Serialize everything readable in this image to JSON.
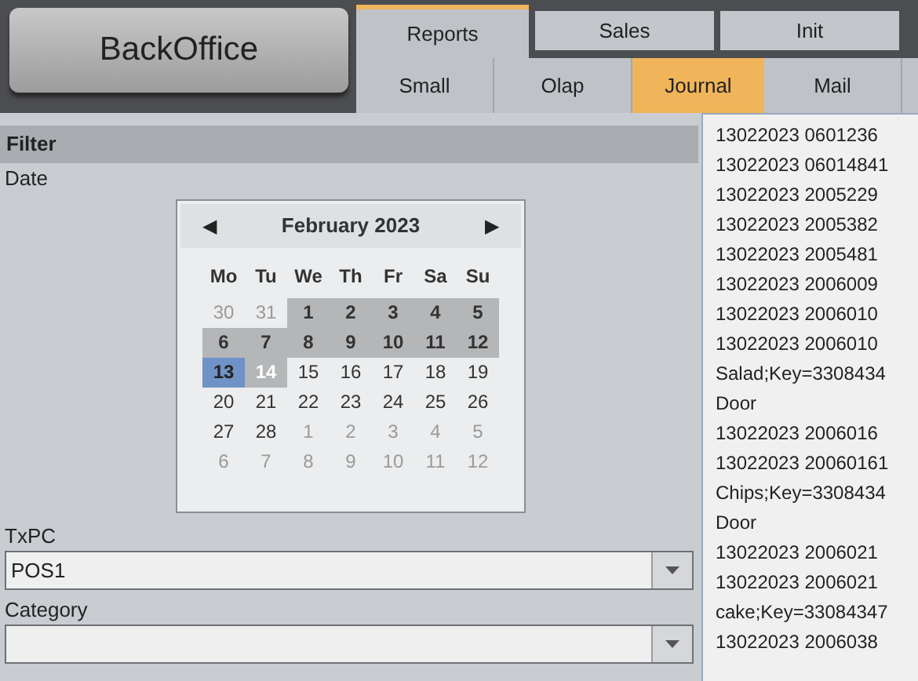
{
  "app_button": "BackOffice",
  "top_tabs": [
    {
      "label": "Reports",
      "selected": true
    },
    {
      "label": "Sales",
      "selected": false
    },
    {
      "label": "Init",
      "selected": false
    }
  ],
  "sub_tabs": [
    {
      "label": "Small",
      "selected": false
    },
    {
      "label": "Olap",
      "selected": false
    },
    {
      "label": "Journal",
      "selected": true
    },
    {
      "label": "Mail",
      "selected": false
    }
  ],
  "filter": {
    "title": "Filter",
    "date_label": "Date",
    "calendar": {
      "month": "February 2023",
      "prev": "◀",
      "next": "▶",
      "weekdays": [
        "Mo",
        "Tu",
        "We",
        "Th",
        "Fr",
        "Sa",
        "Su"
      ],
      "days": [
        {
          "day": "30",
          "other_month": true,
          "in_range": false,
          "selected": false,
          "today": false
        },
        {
          "day": "31",
          "other_month": true,
          "in_range": false,
          "selected": false,
          "today": false
        },
        {
          "day": "1",
          "other_month": false,
          "in_range": true,
          "selected": false,
          "today": false
        },
        {
          "day": "2",
          "other_month": false,
          "in_range": true,
          "selected": false,
          "today": false
        },
        {
          "day": "3",
          "other_month": false,
          "in_range": true,
          "selected": false,
          "today": false
        },
        {
          "day": "4",
          "other_month": false,
          "in_range": true,
          "selected": false,
          "today": false
        },
        {
          "day": "5",
          "other_month": false,
          "in_range": true,
          "selected": false,
          "today": false
        },
        {
          "day": "6",
          "other_month": false,
          "in_range": true,
          "selected": false,
          "today": false
        },
        {
          "day": "7",
          "other_month": false,
          "in_range": true,
          "selected": false,
          "today": false
        },
        {
          "day": "8",
          "other_month": false,
          "in_range": true,
          "selected": false,
          "today": false
        },
        {
          "day": "9",
          "other_month": false,
          "in_range": true,
          "selected": false,
          "today": false
        },
        {
          "day": "10",
          "other_month": false,
          "in_range": true,
          "selected": false,
          "today": false
        },
        {
          "day": "11",
          "other_month": false,
          "in_range": true,
          "selected": false,
          "today": false
        },
        {
          "day": "12",
          "other_month": false,
          "in_range": true,
          "selected": false,
          "today": false
        },
        {
          "day": "13",
          "other_month": false,
          "in_range": false,
          "selected": true,
          "today": false
        },
        {
          "day": "14",
          "other_month": false,
          "in_range": false,
          "selected": false,
          "today": true
        },
        {
          "day": "15",
          "other_month": false,
          "in_range": false,
          "selected": false,
          "today": false
        },
        {
          "day": "16",
          "other_month": false,
          "in_range": false,
          "selected": false,
          "today": false
        },
        {
          "day": "17",
          "other_month": false,
          "in_range": false,
          "selected": false,
          "today": false
        },
        {
          "day": "18",
          "other_month": false,
          "in_range": false,
          "selected": false,
          "today": false
        },
        {
          "day": "19",
          "other_month": false,
          "in_range": false,
          "selected": false,
          "today": false
        },
        {
          "day": "20",
          "other_month": false,
          "in_range": false,
          "selected": false,
          "today": false
        },
        {
          "day": "21",
          "other_month": false,
          "in_range": false,
          "selected": false,
          "today": false
        },
        {
          "day": "22",
          "other_month": false,
          "in_range": false,
          "selected": false,
          "today": false
        },
        {
          "day": "23",
          "other_month": false,
          "in_range": false,
          "selected": false,
          "today": false
        },
        {
          "day": "24",
          "other_month": false,
          "in_range": false,
          "selected": false,
          "today": false
        },
        {
          "day": "25",
          "other_month": false,
          "in_range": false,
          "selected": false,
          "today": false
        },
        {
          "day": "26",
          "other_month": false,
          "in_range": false,
          "selected": false,
          "today": false
        },
        {
          "day": "27",
          "other_month": false,
          "in_range": false,
          "selected": false,
          "today": false
        },
        {
          "day": "28",
          "other_month": false,
          "in_range": false,
          "selected": false,
          "today": false
        },
        {
          "day": "1",
          "other_month": true,
          "in_range": false,
          "selected": false,
          "today": false
        },
        {
          "day": "2",
          "other_month": true,
          "in_range": false,
          "selected": false,
          "today": false
        },
        {
          "day": "3",
          "other_month": true,
          "in_range": false,
          "selected": false,
          "today": false
        },
        {
          "day": "4",
          "other_month": true,
          "in_range": false,
          "selected": false,
          "today": false
        },
        {
          "day": "5",
          "other_month": true,
          "in_range": false,
          "selected": false,
          "today": false
        },
        {
          "day": "6",
          "other_month": true,
          "in_range": false,
          "selected": false,
          "today": false
        },
        {
          "day": "7",
          "other_month": true,
          "in_range": false,
          "selected": false,
          "today": false
        },
        {
          "day": "8",
          "other_month": true,
          "in_range": false,
          "selected": false,
          "today": false
        },
        {
          "day": "9",
          "other_month": true,
          "in_range": false,
          "selected": false,
          "today": false
        },
        {
          "day": "10",
          "other_month": true,
          "in_range": false,
          "selected": false,
          "today": false
        },
        {
          "day": "11",
          "other_month": true,
          "in_range": false,
          "selected": false,
          "today": false
        },
        {
          "day": "12",
          "other_month": true,
          "in_range": false,
          "selected": false,
          "today": false
        }
      ]
    },
    "txpc": {
      "label": "TxPC",
      "value": "POS1"
    },
    "category": {
      "label": "Category"
    }
  },
  "journal_lines": [
    "13022023 0601236",
    "13022023 06014841",
    "13022023 2005229",
    "13022023 2005382",
    "13022023 2005481",
    "13022023 2006009",
    "13022023 2006010",
    "13022023 2006010",
    "Salad;Key=3308434",
    "Door",
    "13022023 2006016",
    "13022023 20060161",
    "Chips;Key=3308434",
    "Door",
    "13022023 2006021",
    "13022023 2006021",
    "cake;Key=33084347",
    "13022023 2006038"
  ]
}
